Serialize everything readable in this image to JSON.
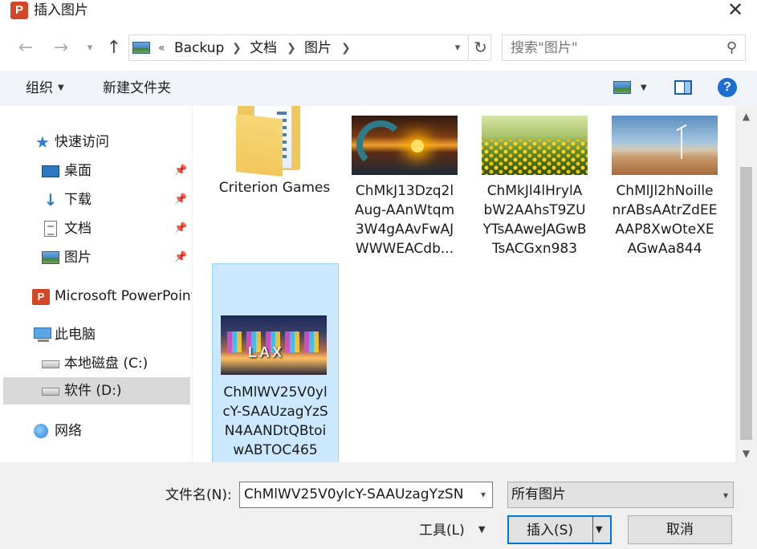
{
  "window": {
    "title": "插入图片",
    "app_icon_letter": "P"
  },
  "navigation": {
    "path": [
      "Backup",
      "文档",
      "图片"
    ],
    "overflow": "«",
    "search_placeholder": "搜索\"图片\""
  },
  "toolbar": {
    "organize": "组织",
    "new_folder": "新建文件夹"
  },
  "sidebar": {
    "items": [
      {
        "label": "快速访问",
        "icon": "star-icon",
        "pinned": false
      },
      {
        "label": "桌面",
        "icon": "desktop-icon",
        "pinned": true
      },
      {
        "label": "下载",
        "icon": "download-icon",
        "pinned": true
      },
      {
        "label": "文档",
        "icon": "document-icon",
        "pinned": true
      },
      {
        "label": "图片",
        "icon": "pictures-icon",
        "pinned": true
      },
      {
        "label": "Microsoft PowerPoint",
        "icon": "powerpoint-icon",
        "pinned": false
      },
      {
        "label": "此电脑",
        "icon": "computer-icon",
        "pinned": false
      },
      {
        "label": "本地磁盘 (C:)",
        "icon": "drive-icon",
        "pinned": false
      },
      {
        "label": "软件 (D:)",
        "icon": "drive-icon",
        "pinned": false,
        "selected": true
      },
      {
        "label": "网络",
        "icon": "network-icon",
        "pinned": false
      }
    ]
  },
  "files": [
    {
      "type": "folder",
      "label_lines": [
        "Criterion Games"
      ]
    },
    {
      "type": "image",
      "label_lines": [
        "ChMkJ13Dzq2l",
        "Aug-AAnWtqm",
        "3W4gAAvFwAJ",
        "WWWEACdb..."
      ]
    },
    {
      "type": "image",
      "label_lines": [
        "ChMkJl4lHrylA",
        "bW2AAhsT9ZU",
        "YTsAAweJAGwB",
        "TsACGxn983"
      ]
    },
    {
      "type": "image",
      "label_lines": [
        "ChMlJl2hNoille",
        "nrABsAAtrZdEE",
        "AAP8XwOteXE",
        "AGwAa844"
      ]
    },
    {
      "type": "image",
      "selected": true,
      "label_lines": [
        "ChMlWV25V0yl",
        "cY-SAAUzagYzS",
        "N4AANDtQBtoi",
        "wABTOC465"
      ]
    }
  ],
  "footer": {
    "filename_label": "文件名(N):",
    "filename_value": "ChMlWV25V0ylcY-SAAUzagYzSN",
    "filetype": "所有图片",
    "tools": "工具(L)",
    "insert": "插入(S)",
    "cancel": "取消"
  }
}
